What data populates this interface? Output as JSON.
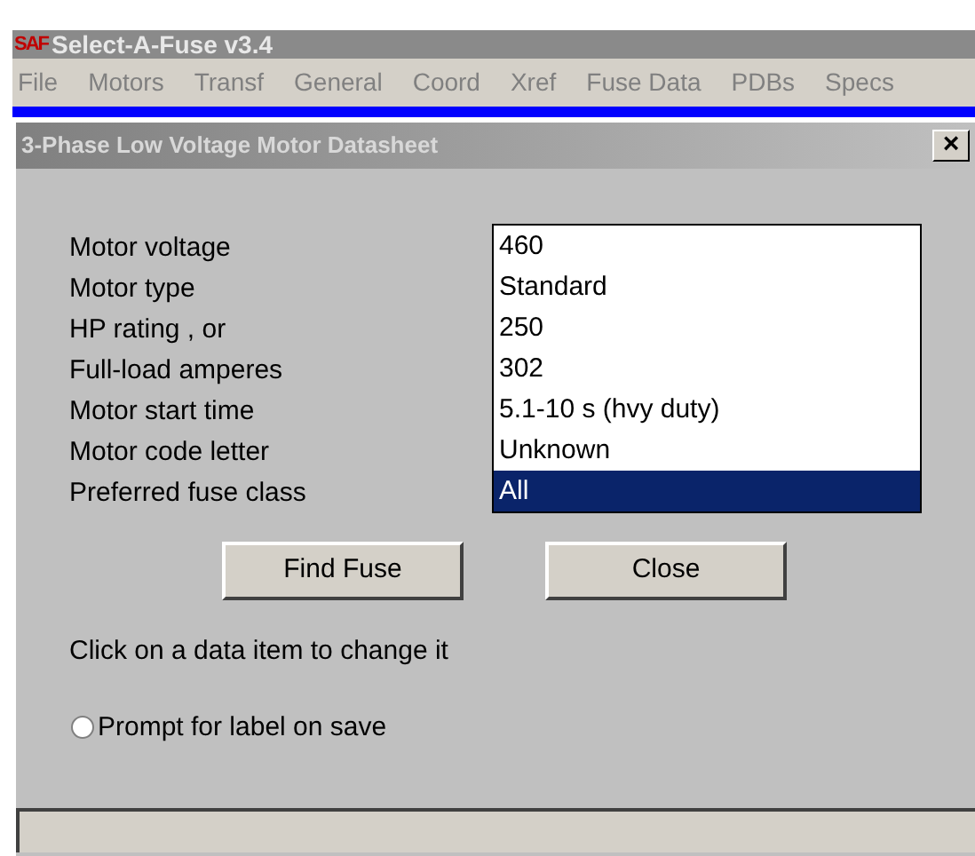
{
  "window": {
    "title": "Select-A-Fuse v3.4",
    "logo": "SAF"
  },
  "menu": [
    {
      "label": "File"
    },
    {
      "label": "Motors"
    },
    {
      "label": "Transf"
    },
    {
      "label": "General"
    },
    {
      "label": "Coord"
    },
    {
      "label": "Xref"
    },
    {
      "label": "Fuse Data"
    },
    {
      "label": "PDBs"
    },
    {
      "label": "Specs"
    }
  ],
  "dialog": {
    "title": "3-Phase Low Voltage Motor Datasheet",
    "close": "×",
    "fields": [
      {
        "label": "Motor voltage",
        "value": "460",
        "selected": false
      },
      {
        "label": "Motor type",
        "value": "Standard",
        "selected": false
      },
      {
        "label": "HP rating , or",
        "value": "250",
        "selected": false
      },
      {
        "label": "Full-load amperes",
        "value": "302",
        "selected": false
      },
      {
        "label": "Motor start time",
        "value": "5.1-10 s (hvy duty)",
        "selected": false
      },
      {
        "label": "Motor code letter",
        "value": "Unknown",
        "selected": false
      },
      {
        "label": "Preferred fuse class",
        "value": "All",
        "selected": true
      }
    ],
    "buttons": [
      "Find Fuse",
      "Close"
    ],
    "hint": "Click on a data item to change it",
    "option": {
      "label": "Prompt for label on save",
      "selected": false
    }
  }
}
